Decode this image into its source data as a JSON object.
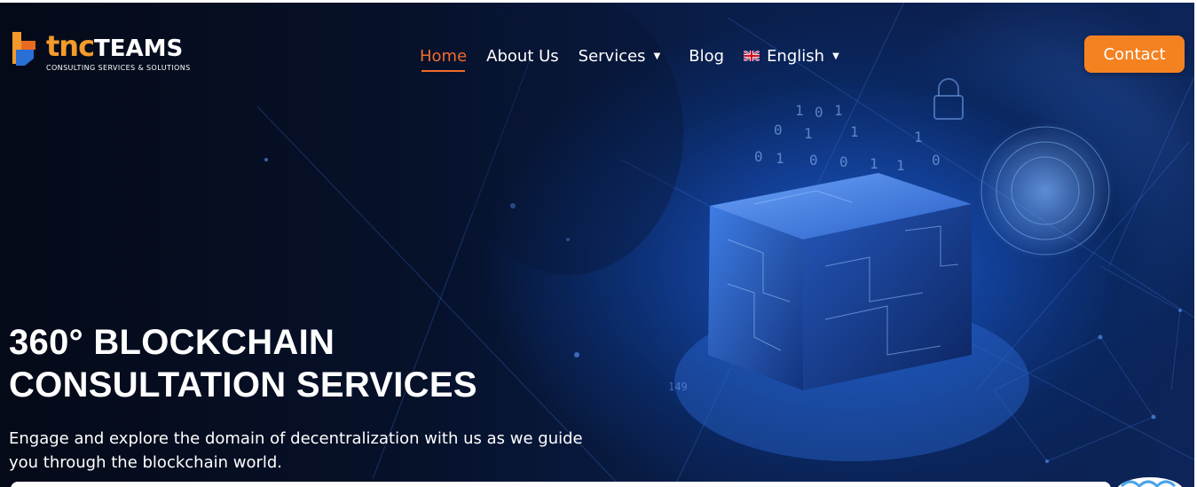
{
  "brand": {
    "name_part1": "tnc",
    "name_part2": "TEAMS",
    "tagline": "CONSULTING SERVICES & SOLUTIONS",
    "orange": "#f39a2b",
    "blue": "#2a6fd6"
  },
  "nav": {
    "items": [
      {
        "label": "Home",
        "active": true
      },
      {
        "label": "About Us"
      },
      {
        "label": "Services",
        "has_dropdown": true
      },
      {
        "label": "Blog"
      },
      {
        "label": "English",
        "has_dropdown": true,
        "icon": "uk-flag-icon"
      }
    ],
    "active_color": "#f26b2d"
  },
  "contact": {
    "label": "Contact",
    "color": "#f58220"
  },
  "hero": {
    "title_line1": "360° BLOCKCHAIN",
    "title_line2": "CONSULTATION SERVICES",
    "subtitle_line1": "Engage and explore the domain of decentralization with us as we guide",
    "subtitle_line2": "you through the blockchain world."
  },
  "bg_digits": [
    "1",
    "0",
    "1",
    "1",
    "0",
    "1",
    "0",
    "0",
    "1",
    "1",
    "0",
    "1",
    "0",
    "1"
  ]
}
